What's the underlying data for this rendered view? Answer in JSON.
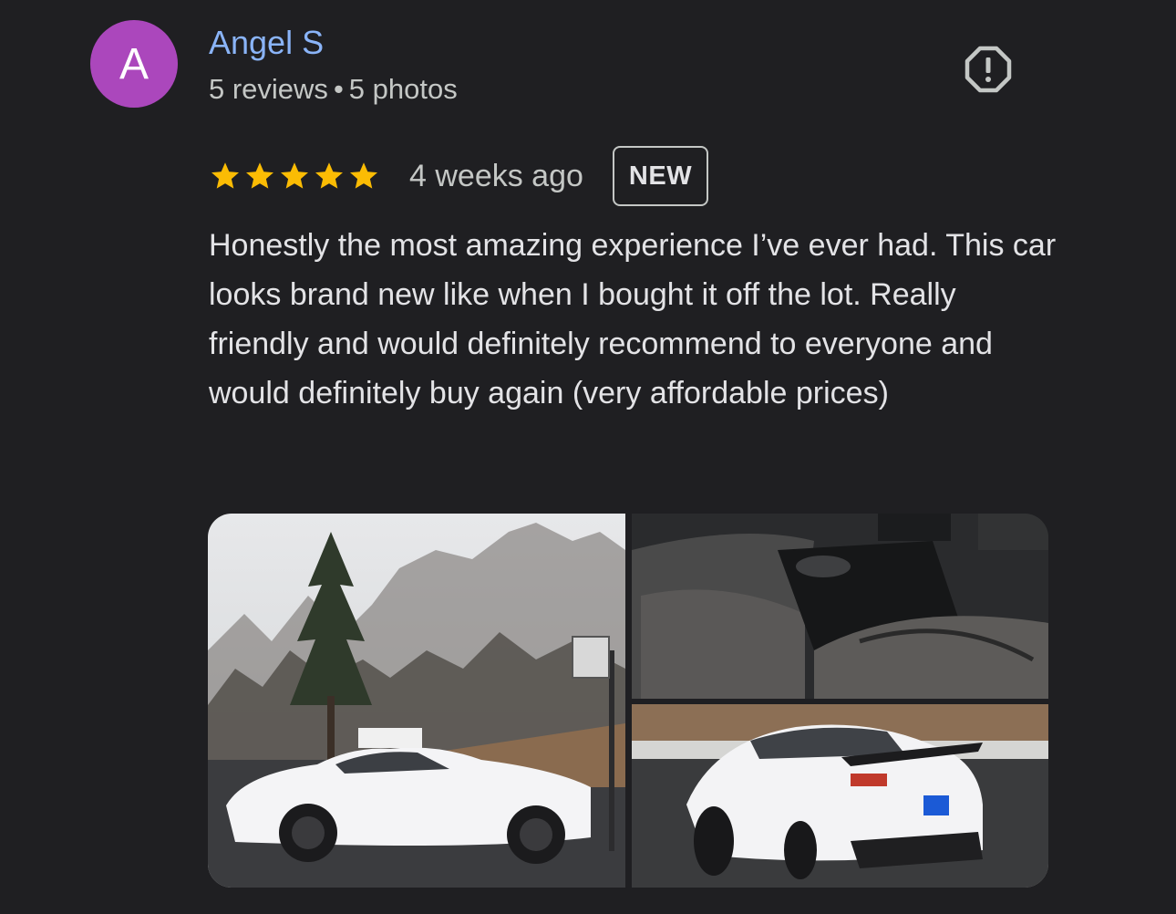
{
  "review": {
    "avatar_letter": "A",
    "author_name": "Angel S",
    "reviews_count": "5 reviews",
    "separator": "•",
    "photos_count": "5 photos",
    "rating": 5,
    "max_rating": 5,
    "time_ago": "4 weeks ago",
    "badge": "NEW",
    "text": "Honestly the most amazing experience I’ve ever had. This car looks brand new like when I bought it off the lot. Really friendly and would definitely recommend to everyone and would definitely buy again (very affordable prices)"
  },
  "icons": {
    "report": "report-octagon-icon",
    "star": "star-icon"
  },
  "colors": {
    "background": "#1f1f22",
    "author": "#8ab4f8",
    "avatar": "#ab47bc",
    "star": "#fbbc04",
    "text": "#e3e3e6",
    "secondary_text": "#c4c7c5"
  }
}
